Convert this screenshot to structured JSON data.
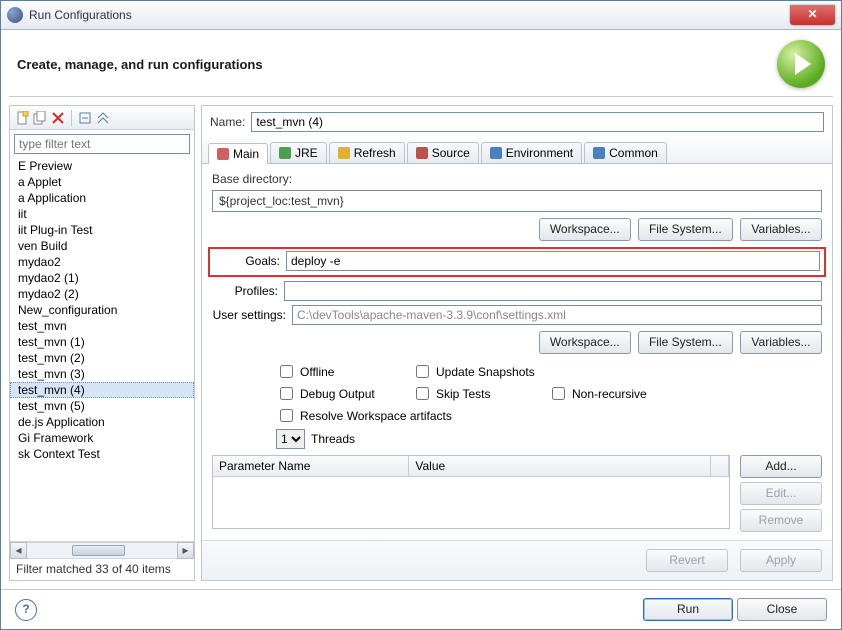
{
  "titlebar": {
    "title": "Run Configurations"
  },
  "header": {
    "title": "Create, manage, and run configurations"
  },
  "sidebar": {
    "filter_placeholder": "type filter text",
    "items": [
      "E Preview",
      "a Applet",
      "a Application",
      "iit",
      "iit Plug-in Test",
      "ven Build",
      "mydao2",
      "mydao2 (1)",
      "mydao2 (2)",
      "New_configuration",
      "test_mvn",
      "test_mvn (1)",
      "test_mvn (2)",
      "test_mvn (3)",
      "test_mvn (4)",
      "test_mvn (5)",
      "de.js Application",
      "Gi Framework",
      "sk Context Test"
    ],
    "selected": "test_mvn (4)",
    "filter_status": "Filter matched 33 of 40 items"
  },
  "main": {
    "name_label": "Name:",
    "name_value": "test_mvn (4)",
    "tabs": [
      "Main",
      "JRE",
      "Refresh",
      "Source",
      "Environment",
      "Common"
    ],
    "active_tab": "Main",
    "base_dir_label": "Base directory:",
    "base_dir_value": "${project_loc:test_mvn}",
    "goals_label": "Goals:",
    "goals_value": "deploy -e",
    "profiles_label": "Profiles:",
    "profiles_value": "",
    "user_settings_label": "User settings:",
    "user_settings_value": "C:\\devTools\\apache-maven-3.3.9\\conf\\settings.xml",
    "btn_workspace": "Workspace...",
    "btn_filesystem": "File System...",
    "btn_variables": "Variables...",
    "ck_offline": "Offline",
    "ck_update": "Update Snapshots",
    "ck_debug": "Debug Output",
    "ck_skip": "Skip Tests",
    "ck_nonrec": "Non-recursive",
    "ck_resolve": "Resolve Workspace artifacts",
    "threads_label": "Threads",
    "threads_value": "1",
    "param_col_name": "Parameter Name",
    "param_col_value": "Value",
    "btn_add": "Add...",
    "btn_edit": "Edit...",
    "btn_remove": "Remove",
    "btn_revert": "Revert",
    "btn_apply": "Apply"
  },
  "footer": {
    "btn_run": "Run",
    "btn_close": "Close"
  }
}
